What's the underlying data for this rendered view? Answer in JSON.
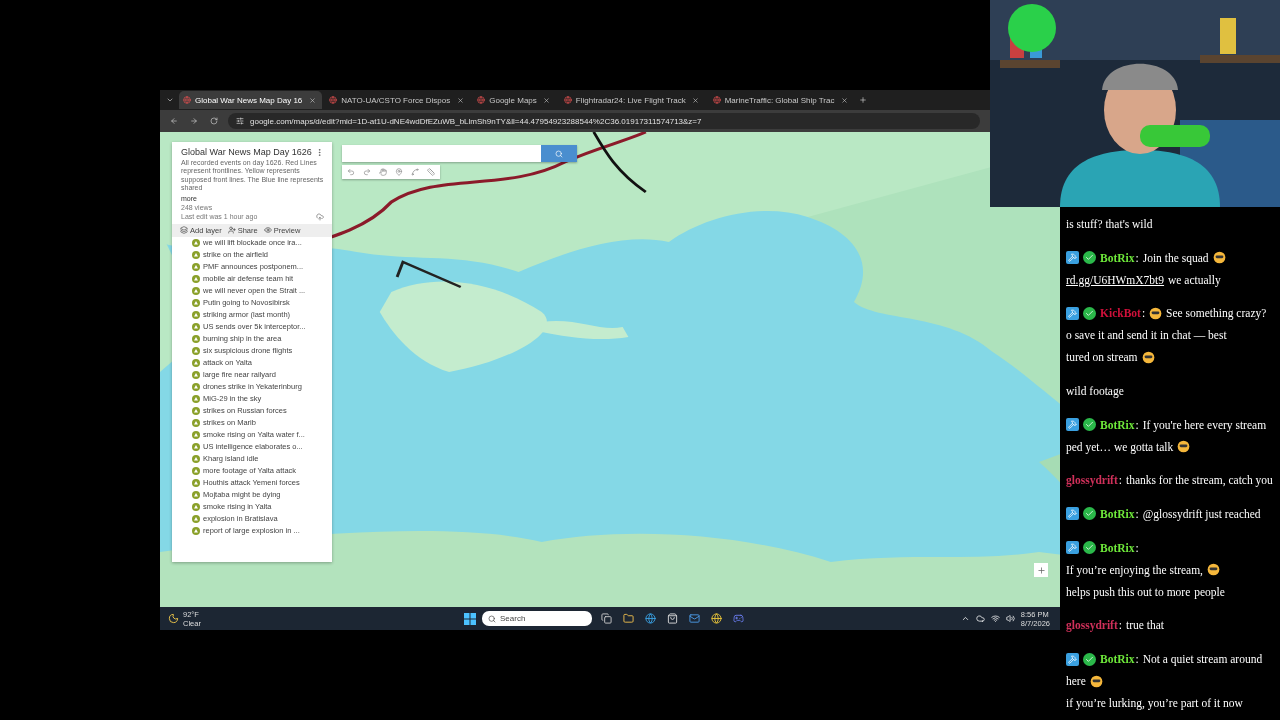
{
  "browser": {
    "tabs": [
      {
        "label": "Global War News Map Day 16",
        "selected": true
      },
      {
        "label": "NATO-UA/CSTO Force Dispos",
        "selected": false
      },
      {
        "label": "Google Maps",
        "selected": false
      },
      {
        "label": "Flightradar24: Live Flight Track",
        "selected": false
      },
      {
        "label": "MarineTraffic: Global Ship Trac",
        "selected": false
      }
    ],
    "url": "google.com/maps/d/edit?mid=1D-at1U-dNE4wdDfEZuWB_bLlmSh9nTY&ll=44.47954923288544%2C36.01917311574713&z=7"
  },
  "map_panel": {
    "title": "Global War News Map Day 1626",
    "description": "All recorded events on day 1626. Red Lines represent frontlines. Yellow represents supposed front lines. The Blue line represents shared",
    "more_link": "more",
    "views": "248 views",
    "last_edit": "Last edit was 1 hour ago",
    "actions": [
      "Add layer",
      "Share",
      "Preview"
    ],
    "items": [
      "we will lift blockade once ira...",
      "strike on the airfield",
      "PMF announces postponem...",
      "mobile air defense team hit",
      "we will never open the Strait ...",
      "Putin going to Novosibirsk",
      "striking armor (last month)",
      "US sends over 5k interceptor...",
      "burning ship in the area",
      "six suspicious drone flights",
      "attack on Yalta",
      "large fire near railyard",
      "drones strike in Yekaterinburg",
      "MiG-29 in the sky",
      "strikes on Russian forces",
      "strikes on Marib",
      "smoke rising on Yalta water f...",
      "US intelligence elaborates o...",
      "Kharg island idle",
      "more footage of Yalta attack",
      "Houthis attack Yemeni forces",
      "Mojtaba might be dying",
      "smoke rising in Yalta",
      "explosion in Bratislava",
      "report of large explosion in ..."
    ]
  },
  "taskbar": {
    "temperature": "92°F",
    "weather": "Clear",
    "search_placeholder": "Search",
    "time": "8:56 PM",
    "date": "8/7/2026"
  },
  "chat": [
    {
      "kind": "fragment",
      "parts": [
        {
          "kind": "text",
          "text": "is stuff? that's wild"
        }
      ]
    },
    {
      "kind": "bot",
      "user": "BotRix",
      "colon": ":",
      "color": "#6ee83a",
      "parts": [
        {
          "kind": "text",
          "text": "Join the squad"
        },
        {
          "kind": "emoji"
        },
        {
          "kind": "link",
          "text": "rd.gg/U6HWmX7bt9"
        },
        {
          "kind": "text",
          "text": "we actually"
        }
      ]
    },
    {
      "kind": "bot",
      "user": "KickBot",
      "colon": ":",
      "color": "#d0103a",
      "parts": [
        {
          "kind": "emoji"
        },
        {
          "kind": "text",
          "text": "See something crazy?"
        },
        {
          "kind": "text",
          "text": "o save it and send it in chat — best"
        },
        {
          "kind": "text",
          "text": "tured on stream"
        },
        {
          "kind": "emoji"
        }
      ]
    },
    {
      "kind": "fragment",
      "parts": [
        {
          "kind": "text",
          "text": "wild footage"
        }
      ]
    },
    {
      "kind": "bot",
      "user": "BotRix",
      "colon": ":",
      "color": "#6ee83a",
      "parts": [
        {
          "kind": "text",
          "text": "If you're here every stream"
        },
        {
          "kind": "text",
          "text": "ped yet… we gotta talk"
        },
        {
          "kind": "emoji"
        }
      ]
    },
    {
      "kind": "user",
      "user": "glossydrift",
      "colon": ":",
      "color": "#d0305a",
      "parts": [
        {
          "kind": "text",
          "text": "thanks for the stream, catch you"
        }
      ]
    },
    {
      "kind": "bot",
      "user": "BotRix",
      "colon": ":",
      "color": "#6ee83a",
      "parts": [
        {
          "kind": "text",
          "text": "@glossydrift just reached"
        }
      ]
    },
    {
      "kind": "bot",
      "user": "BotRix",
      "colon": ":",
      "color": "#6ee83a",
      "parts": [
        {
          "kind": "text",
          "text": "If you’re enjoying the stream,"
        },
        {
          "kind": "emoji"
        },
        {
          "kind": "text",
          "text": "helps push this out to more"
        },
        {
          "kind": "text",
          "text": "people"
        }
      ]
    },
    {
      "kind": "user",
      "user": "glossydrift",
      "colon": ":",
      "color": "#d0305a",
      "parts": [
        {
          "kind": "text",
          "text": "true that"
        }
      ]
    },
    {
      "kind": "bot",
      "user": "BotRix",
      "colon": ":",
      "color": "#6ee83a",
      "parts": [
        {
          "kind": "text",
          "text": "Not a quiet stream around"
        },
        {
          "kind": "text",
          "text": "here"
        },
        {
          "kind": "emoji"
        },
        {
          "kind": "text",
          "text": "if you’re lurking, you’re part of it now"
        }
      ]
    }
  ]
}
